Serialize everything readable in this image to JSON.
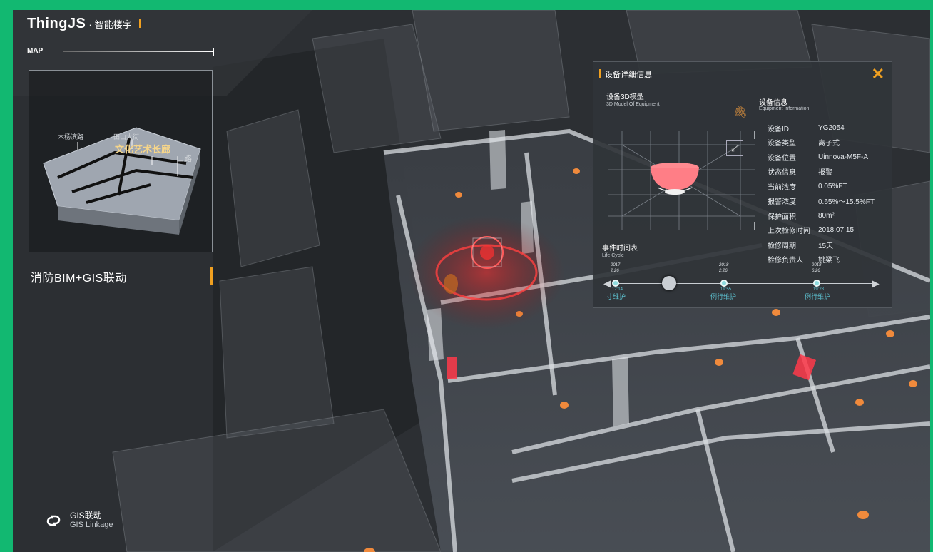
{
  "header": {
    "brand": "ThingJS",
    "brand_dot": "·",
    "subtitle": "智能楼宇"
  },
  "map": {
    "label": "MAP",
    "streets": [
      "木杨滨路",
      "田山大街"
    ],
    "highlight": "文化艺术长廊",
    "side_label": "山路"
  },
  "section_title": "消防BIM+GIS联动",
  "gis_link": {
    "cn": "GIS联动",
    "en": "GIS Linkage",
    "icon": "link-icon"
  },
  "panel": {
    "title": "设备详细信息",
    "model_title": "设备3D模型",
    "model_subtitle": "3D Model Of Equipment",
    "info_title": "设备信息",
    "info_subtitle": "Equipment Information",
    "info": [
      {
        "key": "设备ID",
        "value": "YG2054"
      },
      {
        "key": "设备类型",
        "value": "离子式"
      },
      {
        "key": "设备位置",
        "value": "Uinnova-M5F-A"
      },
      {
        "key": "状态信息",
        "value": "报警"
      },
      {
        "key": "当前浓度",
        "value": "0.05%FT"
      },
      {
        "key": "报警浓度",
        "value": "0.65%～15.5%FT"
      },
      {
        "key": "保护面积",
        "value": "80m²"
      },
      {
        "key": "上次检修时间",
        "value": "2018.07.15"
      },
      {
        "key": "检修周期",
        "value": "15天"
      },
      {
        "key": "检修负责人",
        "value": "姚梁飞"
      }
    ],
    "life_title": "事件时间表",
    "life_subtitle": "Life Cycle",
    "timeline": [
      {
        "year": "2017",
        "date": "2.26",
        "time": "12:14",
        "label": "寸维护"
      },
      {
        "year": "2018",
        "date": "2.26",
        "time": "19:55",
        "label": "例行维护"
      },
      {
        "year": "2018",
        "date": "6.26",
        "time": "19:28",
        "label": "例行维护"
      }
    ]
  },
  "colors": {
    "frame": "#12b871",
    "accent": "#f0a020",
    "alarm": "#ff3b3b",
    "timeline": "#5fc8d8"
  }
}
